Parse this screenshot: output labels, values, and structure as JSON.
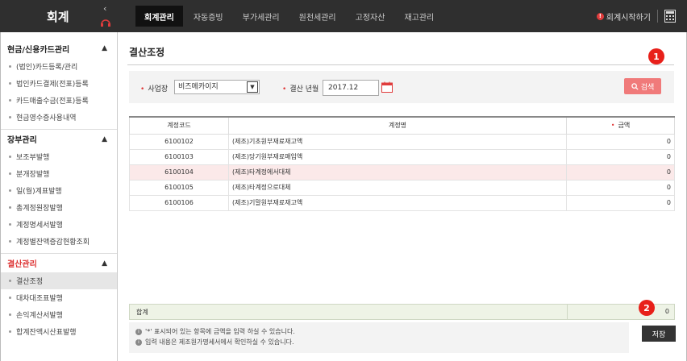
{
  "app": {
    "title": "회계"
  },
  "nav": {
    "items": [
      {
        "label": "회계관리",
        "active": true
      },
      {
        "label": "자동증빙"
      },
      {
        "label": "부가세관리"
      },
      {
        "label": "원천세관리"
      },
      {
        "label": "고정자산"
      },
      {
        "label": "재고관리"
      }
    ],
    "start_label": "회계시작하기",
    "icons": {
      "collapse": "chevron-left-icon",
      "support": "headset-icon",
      "info": "info-icon",
      "calculator": "calculator-icon"
    }
  },
  "sidebar": {
    "groups": [
      {
        "title": "현금/신용카드관리",
        "items": [
          "(법인)카드등록/관리",
          "법인카드결제(전표)등록",
          "카드매출수금(전표)등록",
          "현금영수증사용내역"
        ]
      },
      {
        "title": "장부관리",
        "items": [
          "보조부발행",
          "분개장발행",
          "일(월)계표발행",
          "총계정원장발행",
          "계정명세서발행",
          "계정별잔액증감현황조회"
        ]
      },
      {
        "title": "결산관리",
        "items": [
          "결산조정",
          "대차대조표발행",
          "손익계산서발행",
          "합계잔액시산표발행"
        ]
      }
    ]
  },
  "main": {
    "title": "결산조정",
    "search": {
      "required_mark": "•",
      "business_label": "사업장",
      "business_value": "비즈메카이지",
      "period_label": "결산 년월",
      "period_value": "2017.12",
      "search_label": "검색"
    },
    "table": {
      "headers": {
        "code": "계정코드",
        "name": "계정명",
        "amount": "금액"
      },
      "rows": [
        {
          "code": "6100102",
          "name": "(제조)기초원부재료재고액",
          "amount": "0"
        },
        {
          "code": "6100103",
          "name": "(제조)당기원부재료매입액",
          "amount": "0"
        },
        {
          "code": "6100104",
          "name": "(제조)타계정에서대체",
          "amount": "0"
        },
        {
          "code": "6100105",
          "name": "(제조)타계정으로대체",
          "amount": "0"
        },
        {
          "code": "6100106",
          "name": "(제조)기말원부재료재고액",
          "amount": "0"
        }
      ]
    },
    "total": {
      "label": "합계",
      "value": "0"
    },
    "notes": [
      "'*' 표시되어 있는 항목에 금액을 입력 하실 수 있습니다.",
      "입력 내용은 제조원가명세서에서 확인하실 수 있습니다."
    ],
    "save_label": "저장",
    "badges": {
      "first": "1",
      "second": "2"
    }
  },
  "colors": {
    "topbar": "#2f2f2f",
    "accent_red": "#e03c3c",
    "search_button": "#f07a7a",
    "highlight_row": "#fbe9e9",
    "total_row": "#eef3e6"
  }
}
